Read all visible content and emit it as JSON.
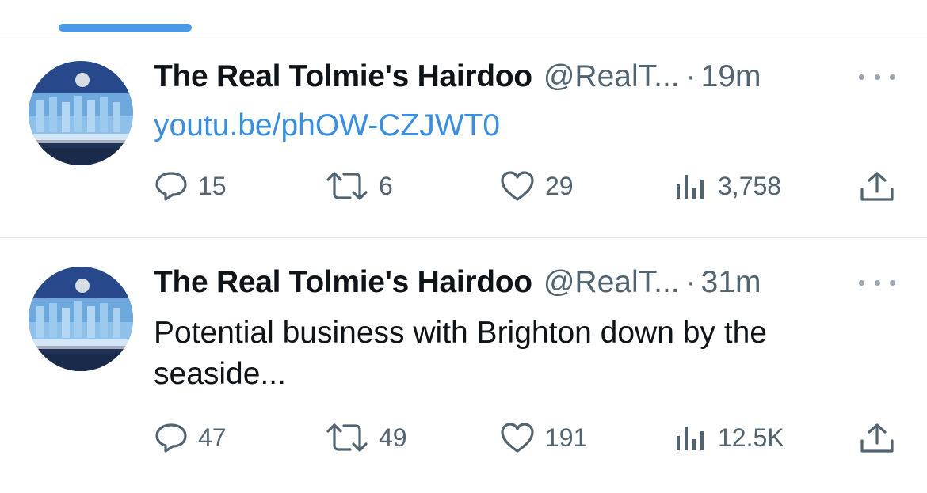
{
  "colors": {
    "link": "#3a8ee0",
    "secondary_text": "#536471",
    "tab_indicator": "#4a99e9"
  },
  "tweets": [
    {
      "display_name": "The Real Tolmie's Hairdoo",
      "handle": "@RealT...",
      "separator": "·",
      "time": "19m",
      "link_text": "youtu.be/phOW-CZJWT0",
      "text": "",
      "replies": "15",
      "retweets": "6",
      "likes": "29",
      "views": "3,758",
      "icons": [
        "reply-icon",
        "retweet-icon",
        "like-icon",
        "views-icon",
        "share-icon",
        "more-icon"
      ]
    },
    {
      "display_name": "The Real Tolmie's Hairdoo",
      "handle": "@RealT...",
      "separator": "·",
      "time": "31m",
      "link_text": "",
      "text": "Potential business with Brighton down by the seaside...",
      "replies": "47",
      "retweets": "49",
      "likes": "191",
      "views": "12.5K",
      "icons": [
        "reply-icon",
        "retweet-icon",
        "like-icon",
        "views-icon",
        "share-icon",
        "more-icon"
      ]
    }
  ]
}
